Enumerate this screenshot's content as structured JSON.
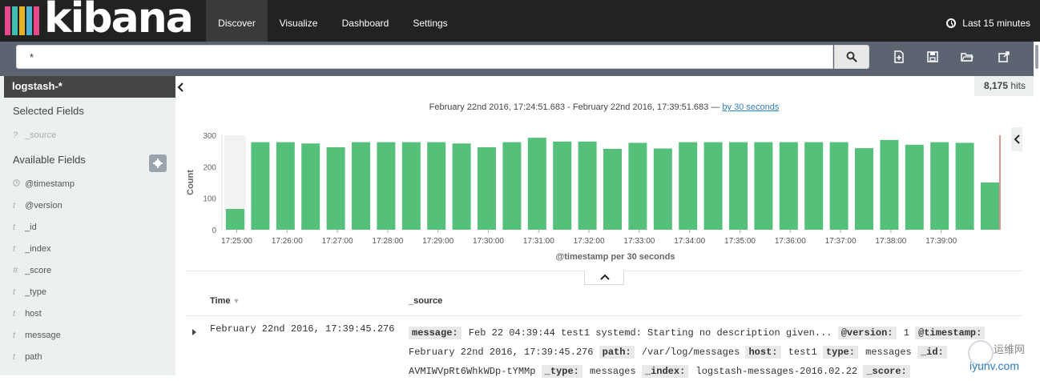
{
  "app": {
    "logo_text": "kibana",
    "logo_colors": [
      "#e8488b",
      "#3ebeb0",
      "#e3b22b",
      "#4bb3d1",
      "#e8488b"
    ]
  },
  "nav": {
    "tabs": [
      {
        "label": "Discover",
        "active": true
      },
      {
        "label": "Visualize",
        "active": false
      },
      {
        "label": "Dashboard",
        "active": false
      },
      {
        "label": "Settings",
        "active": false
      }
    ],
    "timepicker_label": "Last 15 minutes"
  },
  "search": {
    "query": "*"
  },
  "toolbar": {
    "icons": [
      "new-document-icon",
      "save-icon",
      "folder-open-icon",
      "share-icon"
    ]
  },
  "sidebar": {
    "index_pattern": "logstash-*",
    "selected_fields_heading": "Selected Fields",
    "selected_fields": [
      {
        "type": "?",
        "name": "_source"
      }
    ],
    "available_fields_heading": "Available Fields",
    "available_fields": [
      {
        "type": "clock",
        "name": "@timestamp"
      },
      {
        "type": "t",
        "name": "@version"
      },
      {
        "type": "t",
        "name": "_id"
      },
      {
        "type": "t",
        "name": "_index"
      },
      {
        "type": "#",
        "name": "_score"
      },
      {
        "type": "t",
        "name": "_type"
      },
      {
        "type": "t",
        "name": "host"
      },
      {
        "type": "t",
        "name": "message"
      },
      {
        "type": "t",
        "name": "path"
      }
    ]
  },
  "hits": {
    "count": "8,175",
    "label": "hits"
  },
  "histogram": {
    "range_text": "February 22nd 2016, 17:24:51.683 - February 22nd 2016, 17:39:51.683 —",
    "interval_link": "by 30 seconds"
  },
  "chart_data": {
    "type": "bar",
    "title": "",
    "xlabel": "@timestamp per 30 seconds",
    "ylabel": "Count",
    "ylim": [
      0,
      300
    ],
    "yticks": [
      0,
      100,
      200,
      300
    ],
    "bar_color": "#54c07a",
    "xtick_labels": [
      "17:25:00",
      "17:26:00",
      "17:27:00",
      "17:28:00",
      "17:29:00",
      "17:30:00",
      "17:31:00",
      "17:32:00",
      "17:33:00",
      "17:34:00",
      "17:35:00",
      "17:36:00",
      "17:37:00",
      "17:38:00",
      "17:39:00"
    ],
    "values": [
      66,
      278,
      278,
      274,
      262,
      278,
      278,
      278,
      278,
      274,
      262,
      278,
      292,
      280,
      280,
      257,
      276,
      258,
      278,
      278,
      278,
      278,
      278,
      278,
      278,
      259,
      285,
      270,
      278,
      276,
      150
    ]
  },
  "table": {
    "col_time": "Time",
    "col_source": "_source",
    "rows": [
      {
        "time": "February 22nd 2016, 17:39:45.276",
        "source": [
          {
            "k": "message:",
            "v": "Feb 22 04:39:44 test1 systemd: Starting no description given..."
          },
          {
            "k": "@version:",
            "v": "1"
          },
          {
            "k": "@timestamp:",
            "v": "February 22nd 2016, 17:39:45.276"
          },
          {
            "k": "path:",
            "v": "/var/log/messages"
          },
          {
            "k": "host:",
            "v": "test1"
          },
          {
            "k": "type:",
            "v": "messages"
          },
          {
            "k": "_id:",
            "v": "AVMIWVpRt6WhkWDp-tYMMp"
          },
          {
            "k": "_type:",
            "v": "messages"
          },
          {
            "k": "_index:",
            "v": "logstash-messages-2016.02.22"
          },
          {
            "k": "_score:",
            "v": ""
          }
        ]
      }
    ]
  },
  "watermark": {
    "line1": "运维网",
    "line2": "iyunv.com"
  }
}
